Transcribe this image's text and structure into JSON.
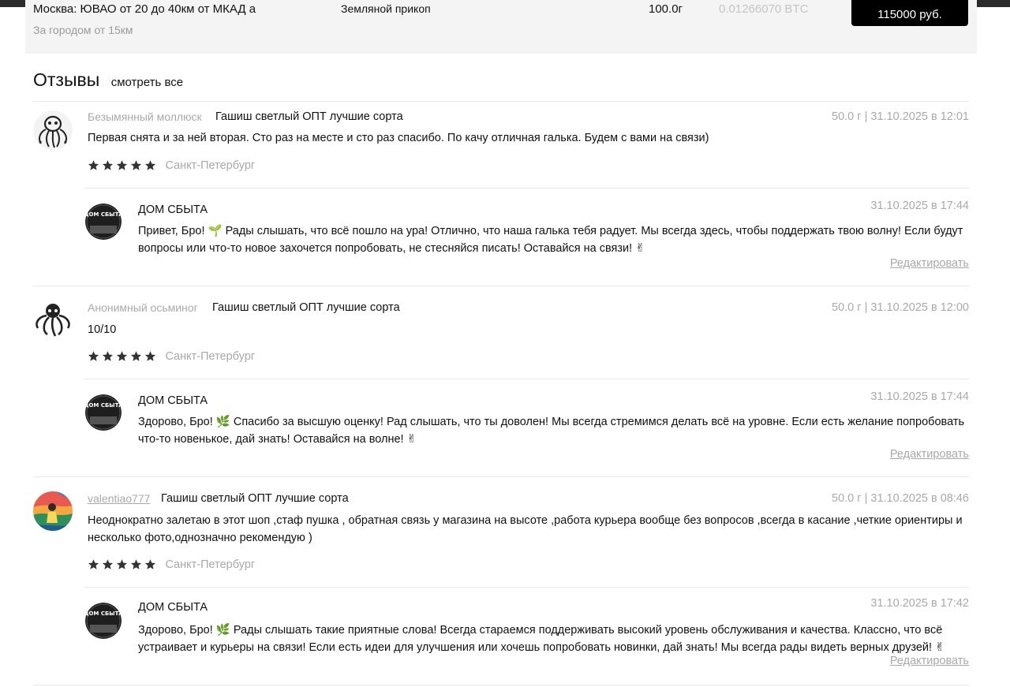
{
  "offer": {
    "location": "Москва: ЮВАО от 20 до 40км от МКАД а",
    "location_sub": "За городом от 15км",
    "method": "Земляной прикоп",
    "weight": "100.0г",
    "btc": "0.01266070 BTC",
    "buy_label": "115000 руб."
  },
  "reviews_header": {
    "title": "Отзывы",
    "see_all": "смотреть все"
  },
  "reviews": [
    {
      "author": "Безымянный моллюск",
      "product": "Гашиш светлый ОПТ лучшие сорта",
      "meta": "50.0 г | 31.10.2025 в 12:01",
      "text": "Первая снята и за ней вторая. Сто раз на месте и сто раз спасибо. По качу отличная галька. Будем с вами на связи)",
      "rating": 5,
      "city": "Санкт-Петербург",
      "avatar_icon": "octopus-avatar-icon",
      "reply": {
        "shop": "ДОМ СБЫТА",
        "date": "31.10.2025 в 17:44",
        "text": "Привет, Бро! 🌱 Рады слышать, что всё пошло на ура! Отлично, что наша галька тебя радует. Мы всегда здесь, чтобы поддержать твою волну! Если будут вопросы или что-то новое захочется попробовать, не стесняйся писать! Оставайся на связи! ✌",
        "edit_label": "Редактировать",
        "avatar_text": "ДОМ СБЫТА"
      }
    },
    {
      "author": "Анонимный осьминог",
      "product": "Гашиш светлый ОПТ лучшие сорта",
      "meta": "50.0 г | 31.10.2025 в 12:00",
      "text": "10/10",
      "rating": 5,
      "city": "Санкт-Петербург",
      "avatar_icon": "octopus-avatar-icon",
      "reply": {
        "shop": "ДОМ СБЫТА",
        "date": "31.10.2025 в 17:44",
        "text": "Здорово, Бро! 🌿 Спасибо за высшую оценку! Рад слышать, что ты доволен! Мы всегда стремимся делать всё на уровне. Если есть желание попробовать что-то новенькое, дай знать! Оставайся на волне! ✌",
        "edit_label": "Редактировать",
        "avatar_text": "ДОМ СБЫТА"
      }
    },
    {
      "author": "valentiao777",
      "product": "Гашиш светлый ОПТ лучшие сорта",
      "meta": "50.0 г | 31.10.2025 в 08:46",
      "text": "Неоднократно залетаю в этот шоп ,стаф пушка , обратная связь у магазина на высоте ,работа курьера вообще без вопросов ,всегда в касание ,четкие ориентиры и несколько фото,однозначно рекомендую )",
      "rating": 5,
      "city": "Санкт-Петербург",
      "avatar_icon": "user-photo-avatar-icon",
      "reply": {
        "shop": "ДОМ СБЫТА",
        "date": "31.10.2025 в 17:42",
        "text": "Здорово, Бро! 🌿 Рады слышать такие приятные слова! Всегда стараемся поддерживать высокий уровень обслуживания и качества. Классно, что всё устраивает и курьеры на связи! Если есть идеи для улучшения или хочешь попробовать новинки, дай знать! Мы всегда рады видеть верных друзей! ✌",
        "edit_label": "Редактировать",
        "avatar_text": "ДОМ СБЫТА"
      }
    }
  ]
}
